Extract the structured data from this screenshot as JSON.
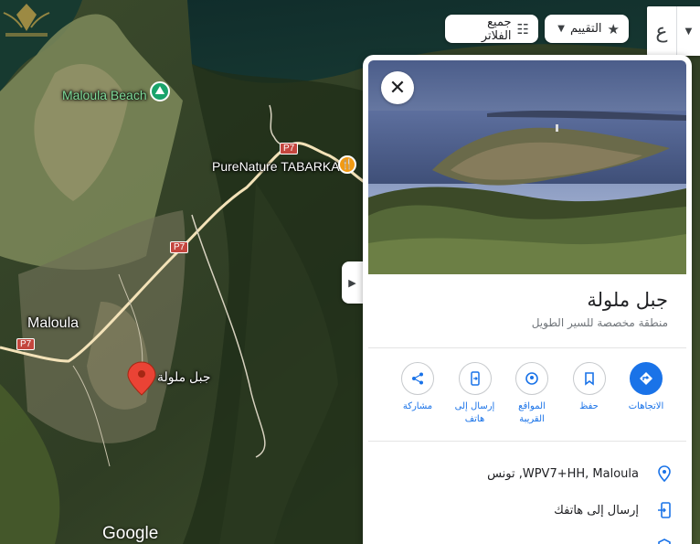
{
  "map": {
    "beach_label": "Maloula Beach",
    "restaurant_label": "PureNature TABARKA",
    "city_label": "Maloula",
    "place_label": "جبل ملولة",
    "road_badges": [
      "P7",
      "P7",
      "P7"
    ],
    "attribution": "Google",
    "icons": {
      "beach": "hiking-icon",
      "restaurant": "fork-knife-icon",
      "place": "red-map-pin-icon"
    },
    "colors": {
      "pin": "#ea4335",
      "road": "#f3e2b8",
      "beach_pin": "#1aa36b",
      "restaurant_pin": "#f29a13"
    }
  },
  "filters": {
    "all_filters_label": "جميع الفلاتر",
    "rating_label": "التقييم",
    "language_letter": "ع"
  },
  "panel": {
    "title": "جبل ملولة",
    "subtitle": "منطقة مخصصة للسير الطويل",
    "actions": [
      {
        "label": "الاتجاهات",
        "icon": "directions-icon",
        "primary": true
      },
      {
        "label": "حفظ",
        "icon": "bookmark-icon",
        "primary": false
      },
      {
        "label": "المواقع القريبة",
        "icon": "nearby-icon",
        "primary": false
      },
      {
        "label": "إرسال إلى هاتف",
        "icon": "send-to-phone-icon",
        "primary": false
      },
      {
        "label": "مشاركة",
        "icon": "share-icon",
        "primary": false
      }
    ],
    "info": [
      {
        "text": "WPV7+HH, Maloula, تونس",
        "icon": "location-pin-icon"
      },
      {
        "text": "إرسال إلى هاتفك",
        "icon": "phone-send-icon"
      },
      {
        "text": "",
        "icon": "shield-icon"
      }
    ],
    "accent_color": "#1a73e8"
  }
}
